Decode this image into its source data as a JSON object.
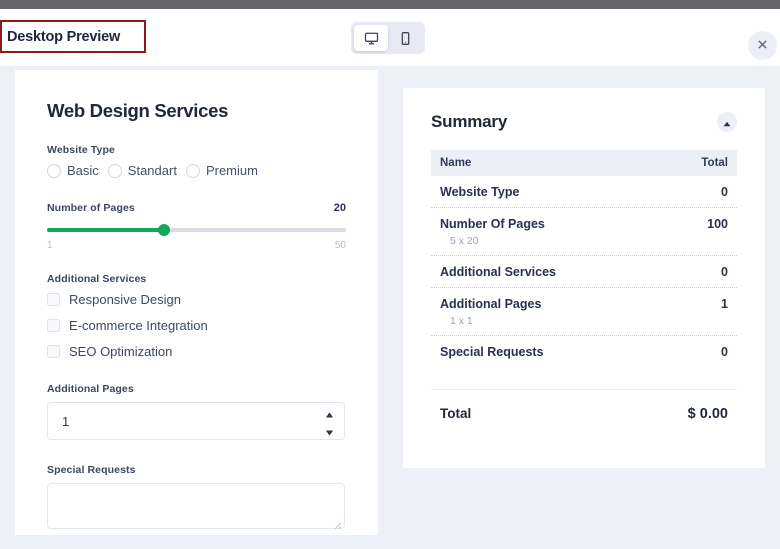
{
  "theme": {
    "accent_green": "#12a85c",
    "canvas_bg": "#edf0f7",
    "highlight_border": "#8b1a1a",
    "text_dark": "#1f2738",
    "top_strip": "#646569"
  },
  "preview_header": {
    "title": "Desktop Preview",
    "devices": [
      {
        "name": "desktop",
        "icon": "monitor-icon",
        "active": true
      },
      {
        "name": "mobile",
        "icon": "mobile-icon",
        "active": false
      }
    ],
    "close_icon": "close-icon"
  },
  "form": {
    "title": "Web Design Services",
    "website_type": {
      "label": "Website Type",
      "options": [
        {
          "label": "Basic",
          "selected": false
        },
        {
          "label": "Standart",
          "selected": false
        },
        {
          "label": "Premium",
          "selected": false
        }
      ]
    },
    "number_of_pages": {
      "label": "Number of Pages",
      "value": "20",
      "min": "1",
      "max": "50",
      "fill_percent": 39
    },
    "additional_services": {
      "label": "Additional Services",
      "options": [
        {
          "label": "Responsive Design",
          "checked": false
        },
        {
          "label": "E-commerce Integration",
          "checked": false
        },
        {
          "label": "SEO Optimization",
          "checked": false
        }
      ]
    },
    "additional_pages": {
      "label": "Additional Pages",
      "value": "1",
      "up_icon": "caret-up-icon",
      "down_icon": "caret-down-icon"
    },
    "special_requests": {
      "label": "Special Requests",
      "value": "",
      "placeholder": ""
    }
  },
  "summary": {
    "title": "Summary",
    "collapse_icon": "caret-up-icon",
    "columns": [
      "Name",
      "Total"
    ],
    "rows": [
      {
        "name": "Website Type",
        "sub": "",
        "total": "0"
      },
      {
        "name": "Number Of Pages",
        "sub": "5 x 20",
        "total": "100"
      },
      {
        "name": "Additional Services",
        "sub": "",
        "total": "0"
      },
      {
        "name": "Additional Pages",
        "sub": "1 x 1",
        "total": "1"
      },
      {
        "name": "Special Requests",
        "sub": "",
        "total": "0"
      }
    ],
    "grand_total": {
      "label": "Total",
      "value": "$ 0.00"
    }
  }
}
